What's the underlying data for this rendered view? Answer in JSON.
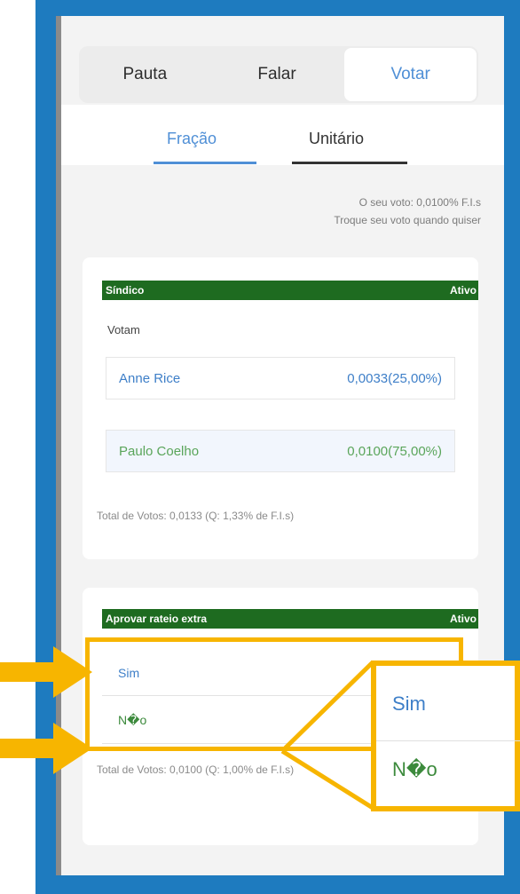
{
  "tabs": [
    {
      "label": "Pauta"
    },
    {
      "label": "Falar"
    },
    {
      "label": "Votar"
    }
  ],
  "subtabs": [
    {
      "label": "Fração"
    },
    {
      "label": "Unitário"
    }
  ],
  "vote_info": {
    "line1": "O seu voto: 0,0100% F.I.s",
    "line2": "Troque seu voto quando quiser"
  },
  "card1": {
    "title": "Síndico",
    "status": "Ativo",
    "subtitle": "Votam",
    "rows": [
      {
        "name": "Anne Rice",
        "value": "0,0033(25,00%)"
      },
      {
        "name": "Paulo Coelho",
        "value": "0,0100(75,00%)"
      }
    ],
    "total": "Total de Votos: 0,0133 (Q: 1,33% de F.I.s)"
  },
  "card2": {
    "title": "Aprovar rateio extra",
    "status": "Ativo",
    "options": [
      {
        "label": "Sim"
      },
      {
        "label": "N�o"
      }
    ],
    "total": "Total de Votos: 0,0100 (Q: 1,00% de F.I.s)"
  },
  "zoom": {
    "sim": "Sim",
    "nao": "N�o"
  },
  "colors": {
    "frame": "#1e7bbf",
    "accent": "#4f8fd6",
    "green_bar": "#1e6b20",
    "highlight": "#f7b500"
  }
}
